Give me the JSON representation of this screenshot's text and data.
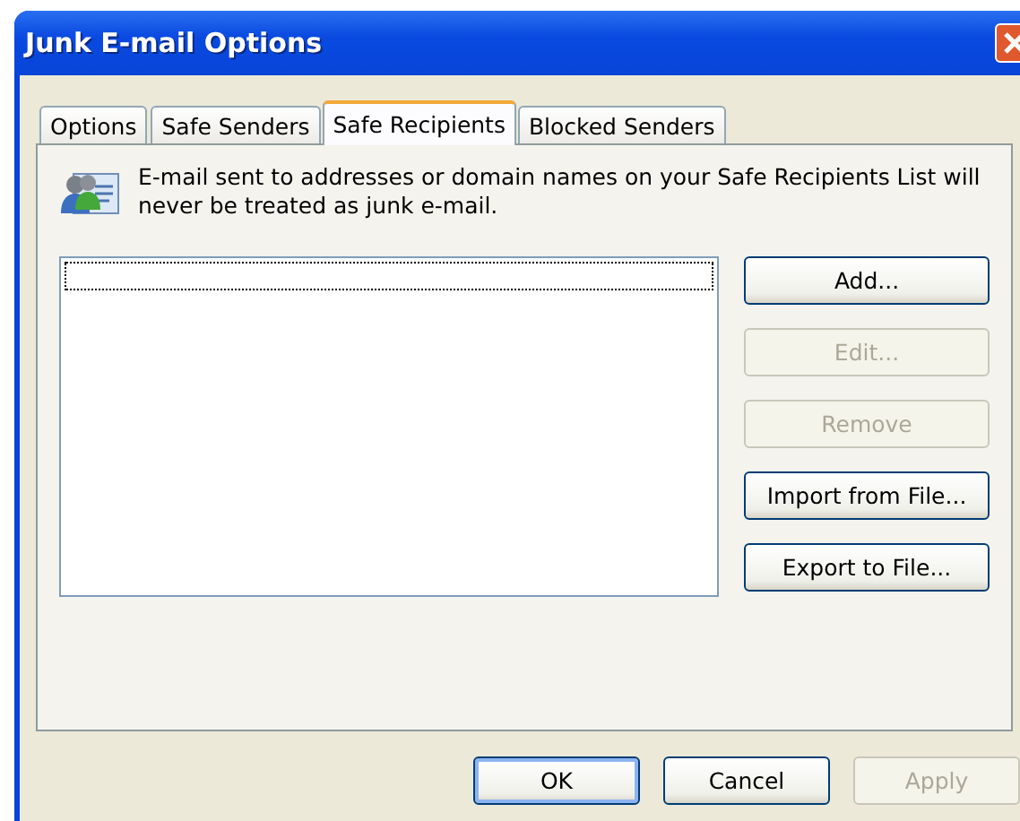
{
  "window": {
    "title": "Junk E-mail Options"
  },
  "tabs": [
    {
      "label": "Options",
      "selected": false
    },
    {
      "label": "Safe Senders",
      "selected": false
    },
    {
      "label": "Safe Recipients",
      "selected": true
    },
    {
      "label": "Blocked Senders",
      "selected": false
    }
  ],
  "description": "E-mail sent to addresses or domain names on your Safe Recipients List will never be treated as junk e-mail.",
  "side_buttons": [
    {
      "label": "Add...",
      "disabled": false
    },
    {
      "label": "Edit...",
      "disabled": true
    },
    {
      "label": "Remove",
      "disabled": true
    },
    {
      "label": "Import from File...",
      "disabled": false
    },
    {
      "label": "Export to File...",
      "disabled": false
    }
  ],
  "footer_buttons": [
    {
      "label": "OK",
      "disabled": false,
      "default": true
    },
    {
      "label": "Cancel",
      "disabled": false,
      "default": false
    },
    {
      "label": "Apply",
      "disabled": true,
      "default": false
    }
  ]
}
